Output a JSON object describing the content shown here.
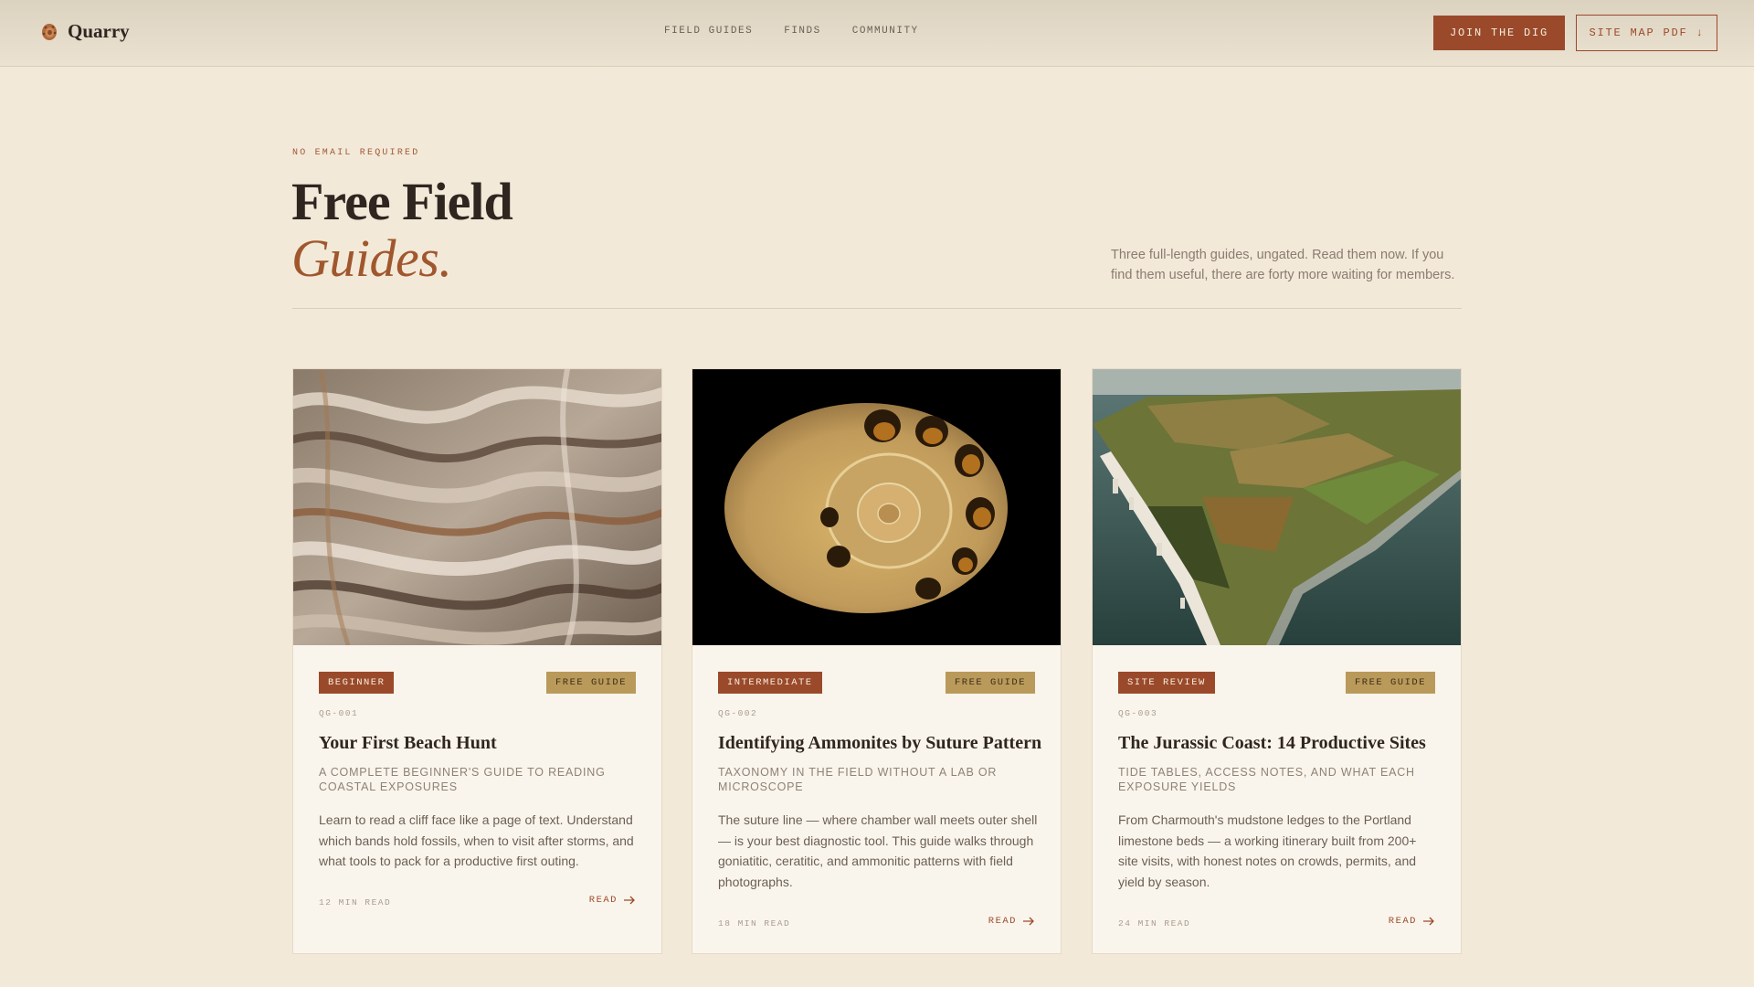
{
  "header": {
    "brand": "Quarry",
    "nav": [
      "FIELD GUIDES",
      "FINDS",
      "COMMUNITY"
    ],
    "join_label": "JOIN THE DIG",
    "pdf_label": "SITE MAP PDF ↓"
  },
  "hero": {
    "eyebrow": "NO EMAIL REQUIRED",
    "title_line1": "Free Field",
    "title_line2": "Guides.",
    "intro": "Three full-length guides, ungated. Read them now. If you find them useful, there are forty more waiting for members."
  },
  "colors": {
    "accent": "#9a4a2a",
    "gold": "#b99a5a",
    "background": "#f3e9d9"
  },
  "cards": [
    {
      "level": "BEGINNER",
      "tag": "FREE GUIDE",
      "code": "QG-001",
      "title": "Your First Beach Hunt",
      "subtitle": "A COMPLETE BEGINNER'S GUIDE TO READING COASTAL EXPOSURES",
      "body": "Learn to read a cliff face like a page of text. Understand which bands hold fossils, when to visit after storms, and what tools to pack for a productive first outing.",
      "read_time": "12 MIN READ",
      "read_label": "READ",
      "image": "rock-strata-photo"
    },
    {
      "level": "INTERMEDIATE",
      "tag": "FREE GUIDE",
      "code": "QG-002",
      "title": "Identifying Ammonites by Suture Pattern",
      "subtitle": "TAXONOMY IN THE FIELD WITHOUT A LAB OR MICROSCOPE",
      "body": "The suture line — where chamber wall meets outer shell — is your best diagnostic tool. This guide walks through goniatitic, ceratitic, and ammonitic patterns with field photographs.",
      "read_time": "18 MIN READ",
      "read_label": "READ",
      "image": "ammonite-fossil-photo"
    },
    {
      "level": "SITE REVIEW",
      "tag": "FREE GUIDE",
      "code": "QG-003",
      "title": "The Jurassic Coast: 14 Productive Sites",
      "subtitle": "TIDE TABLES, ACCESS NOTES, AND WHAT EACH EXPOSURE YIELDS",
      "body": "From Charmouth's mudstone ledges to the Portland limestone beds — a working itinerary built from 200+ site visits, with honest notes on crowds, permits, and yield by season.",
      "read_time": "24 MIN READ",
      "read_label": "READ",
      "image": "coastal-cliffs-photo"
    }
  ]
}
